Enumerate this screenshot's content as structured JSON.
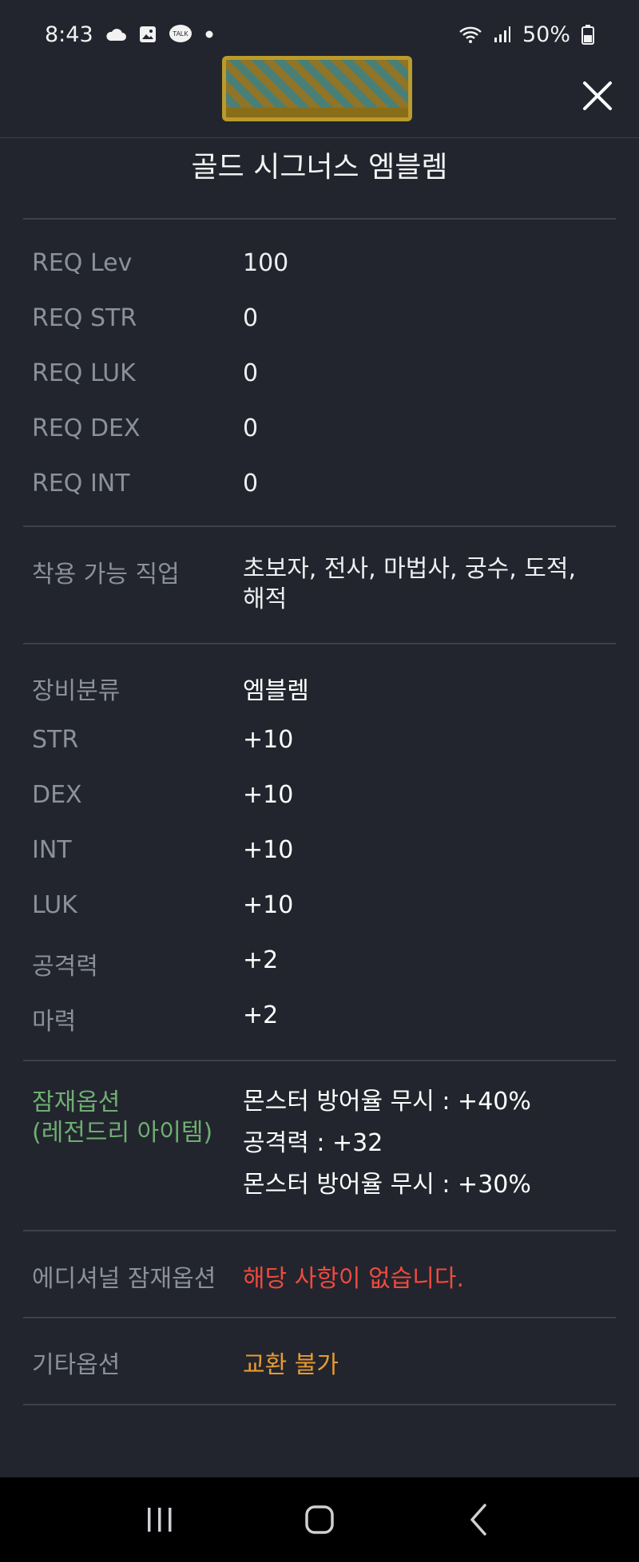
{
  "status_bar": {
    "time": "8:43",
    "battery": "50%",
    "left_icons": [
      "cloud-icon",
      "gallery-icon",
      "kakaotalk-icon",
      "dot-icon"
    ],
    "right_icons": [
      "wifi-icon",
      "signal-icon",
      "battery-icon"
    ],
    "talk_badge": "TALK"
  },
  "item": {
    "name": "골드 시그너스 엠블렘",
    "image_icon": "emblem-icon"
  },
  "requirements": [
    {
      "label": "REQ Lev",
      "value": "100"
    },
    {
      "label": "REQ STR",
      "value": "0"
    },
    {
      "label": "REQ LUK",
      "value": "0"
    },
    {
      "label": "REQ DEX",
      "value": "0"
    },
    {
      "label": "REQ INT",
      "value": "0"
    }
  ],
  "jobs": {
    "label": "착용 가능 직업",
    "value": "초보자, 전사, 마법사, 궁수, 도적, 해적"
  },
  "stats": [
    {
      "label": "장비분류",
      "value": "엠블렘"
    },
    {
      "label": "STR",
      "value": "+10"
    },
    {
      "label": "DEX",
      "value": "+10"
    },
    {
      "label": "INT",
      "value": "+10"
    },
    {
      "label": "LUK",
      "value": "+10"
    },
    {
      "label": "공격력",
      "value": "+2"
    },
    {
      "label": "마력",
      "value": "+2"
    }
  ],
  "potential": {
    "label_line1": "잠재옵션",
    "label_line2": "(레전드리 아이템)",
    "lines": [
      "몬스터 방어율 무시 : +40%",
      "공격력 : +32",
      "몬스터 방어율 무시 : +30%"
    ]
  },
  "additional_potential": {
    "label": "에디셔널 잠재옵션",
    "value": "해당 사항이 없습니다."
  },
  "other_options": {
    "label": "기타옵션",
    "value": "교환 불가"
  },
  "colors": {
    "background": "#22252d",
    "potential_green": "#6fae73",
    "none_red": "#ef4a3f",
    "tradeable_orange": "#e79a33"
  },
  "nav_bar": {
    "icons": [
      "recent-apps-icon",
      "home-icon",
      "back-icon"
    ]
  }
}
